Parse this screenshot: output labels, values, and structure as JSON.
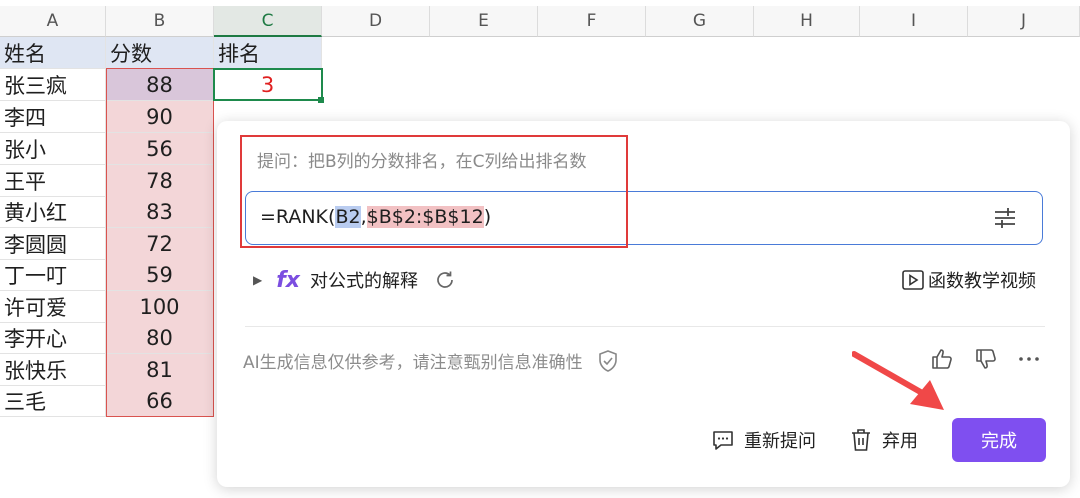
{
  "columns": [
    "A",
    "B",
    "C",
    "D",
    "E",
    "F",
    "G",
    "H",
    "I",
    "J"
  ],
  "headers": {
    "name": "姓名",
    "score": "分数",
    "rank": "排名"
  },
  "rows": [
    {
      "name": "张三疯",
      "score": "88"
    },
    {
      "name": "李四",
      "score": "90"
    },
    {
      "name": "张小",
      "score": "56"
    },
    {
      "name": "王平",
      "score": "78"
    },
    {
      "name": "黄小红",
      "score": "83"
    },
    {
      "name": "李圆圆",
      "score": "72"
    },
    {
      "name": "丁一叮",
      "score": "59"
    },
    {
      "name": "许可爱",
      "score": "100"
    },
    {
      "name": "李开心",
      "score": "80"
    },
    {
      "name": "张快乐",
      "score": "81"
    },
    {
      "name": "三毛",
      "score": "66"
    }
  ],
  "rank_value": "3",
  "ai_panel": {
    "prompt": "提问：把B列的分数排名，在C列给出排名数",
    "formula_prefix": "=RANK(",
    "formula_ref": "B2",
    "formula_comma": ",",
    "formula_range": "$B$2:$B$12",
    "formula_suffix": ")",
    "explain_label": "对公式的解释",
    "fx_label": "fx",
    "video_label": "函数教学视频",
    "disclaimer": "AI生成信息仅供参考，请注意甄别信息准确性",
    "reask_label": "重新提问",
    "discard_label": "弃用",
    "done_label": "完成"
  },
  "colors": {
    "accent": "#7f4ff0",
    "rank_text": "#e02020",
    "selection": "#1e8a4c"
  }
}
